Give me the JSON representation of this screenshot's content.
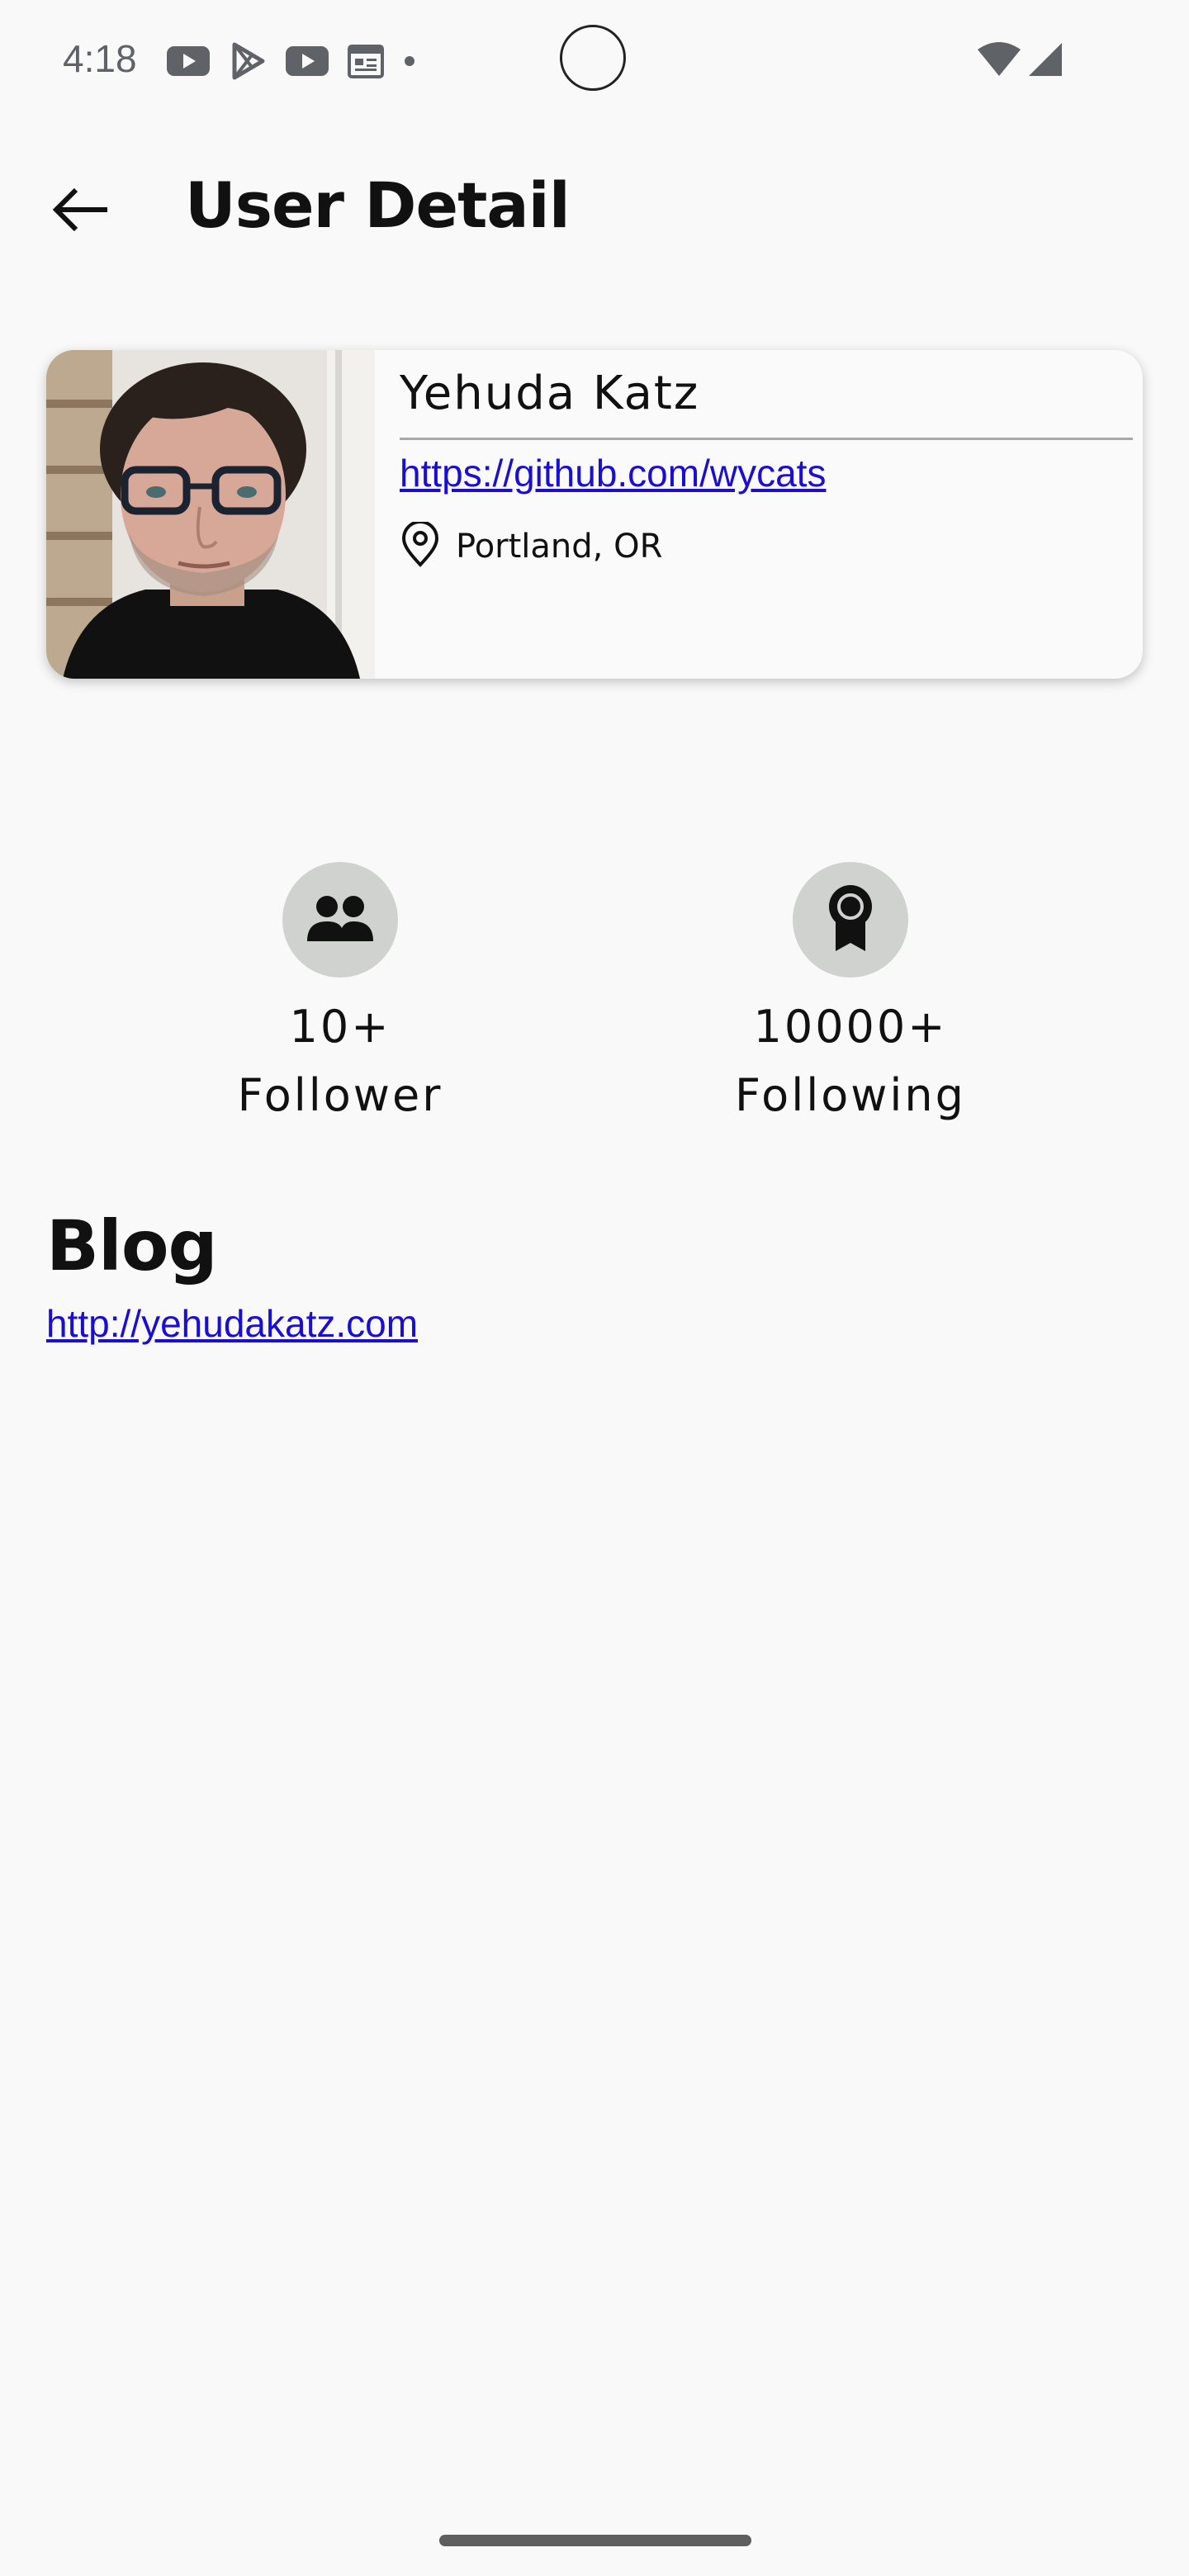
{
  "status_bar": {
    "time": "4:18",
    "left_icons": [
      "youtube-icon",
      "play-store-icon",
      "youtube-icon",
      "calendar-icon",
      "dot-icon"
    ],
    "right_icons": [
      "wifi-icon",
      "signal-icon"
    ]
  },
  "app_bar": {
    "back_icon": "arrow-back-icon",
    "title": "User Detail"
  },
  "profile": {
    "name": "Yehuda Katz",
    "url": "https://github.com/wycats",
    "location": "Portland, OR",
    "location_icon": "location-pin-icon",
    "link_color": "#1a0dd6"
  },
  "stats": {
    "followers": {
      "icon": "people-icon",
      "count": "10+",
      "label": "Follower"
    },
    "following": {
      "icon": "award-badge-icon",
      "count": "10000+",
      "label": "Following"
    },
    "icon_bg_color": "#cfd2cf"
  },
  "blog": {
    "title": "Blog",
    "url": "http://yehudakatz.com"
  }
}
